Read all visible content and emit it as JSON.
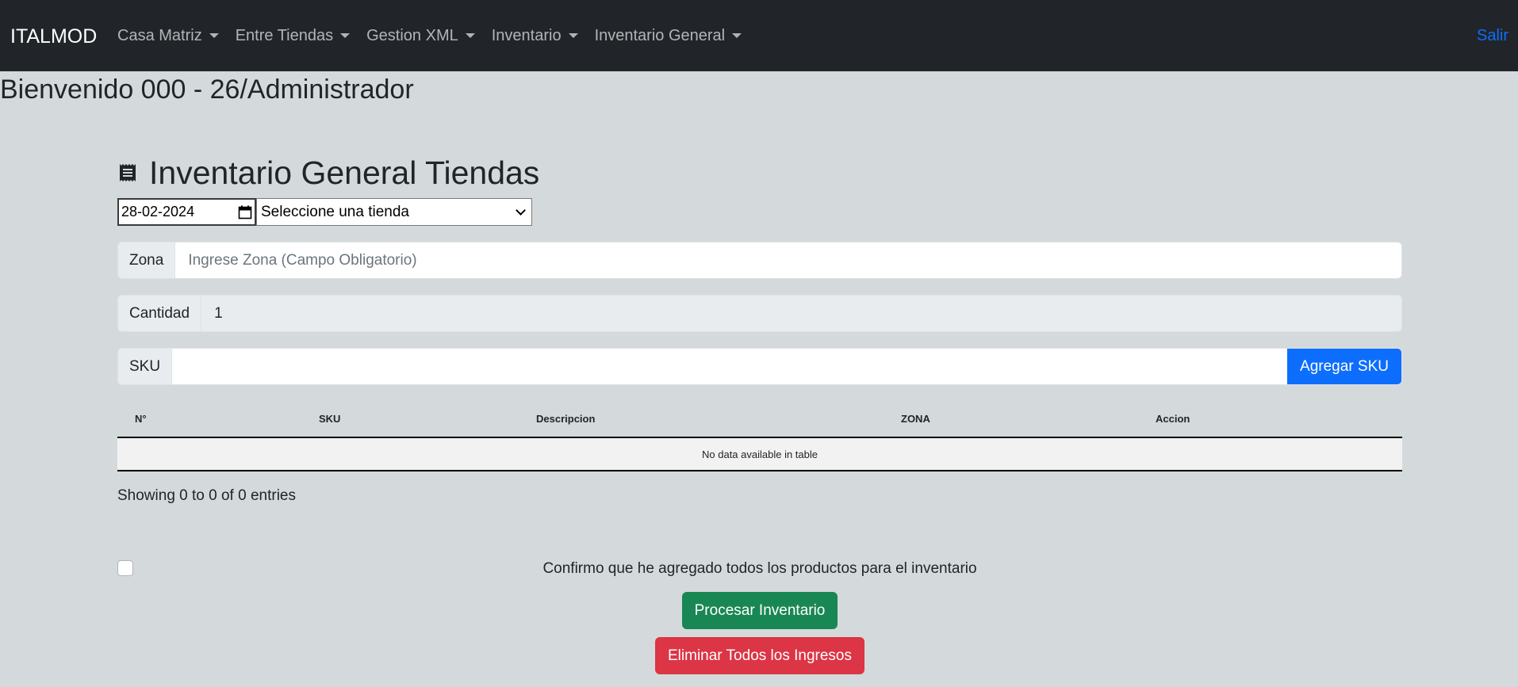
{
  "navbar": {
    "brand": "ITALMOD",
    "menu": [
      {
        "label": "Casa Matriz"
      },
      {
        "label": "Entre Tiendas"
      },
      {
        "label": "Gestion XML"
      },
      {
        "label": "Inventario"
      },
      {
        "label": "Inventario General"
      }
    ],
    "logout": "Salir"
  },
  "welcome": "Bienvenido 000 - 26/Administrador",
  "page": {
    "title": "Inventario General Tiendas",
    "date_value": "28-02-2024",
    "store_select": "Seleccione una tienda",
    "zona": {
      "label": "Zona",
      "placeholder": "Ingrese Zona (Campo Obligatorio)"
    },
    "cantidad": {
      "label": "Cantidad",
      "value": "1"
    },
    "sku": {
      "label": "SKU",
      "value": "",
      "button": "Agregar SKU"
    }
  },
  "table": {
    "columns": [
      "N°",
      "SKU",
      "Descripcion",
      "ZONA",
      "Accion"
    ],
    "empty_message": "No data available in table",
    "info": "Showing 0 to 0 of 0 entries"
  },
  "confirm": {
    "label": "Confirmo que he agregado todos los productos para el inventario",
    "checked": false
  },
  "actions": {
    "process": "Procesar Inventario",
    "delete_all": "Eliminar Todos los Ingresos"
  },
  "colors": {
    "navbar_bg": "#212529",
    "page_bg": "#d4dadb",
    "primary": "#0d6efd",
    "success": "#198754",
    "danger": "#dc3545"
  }
}
